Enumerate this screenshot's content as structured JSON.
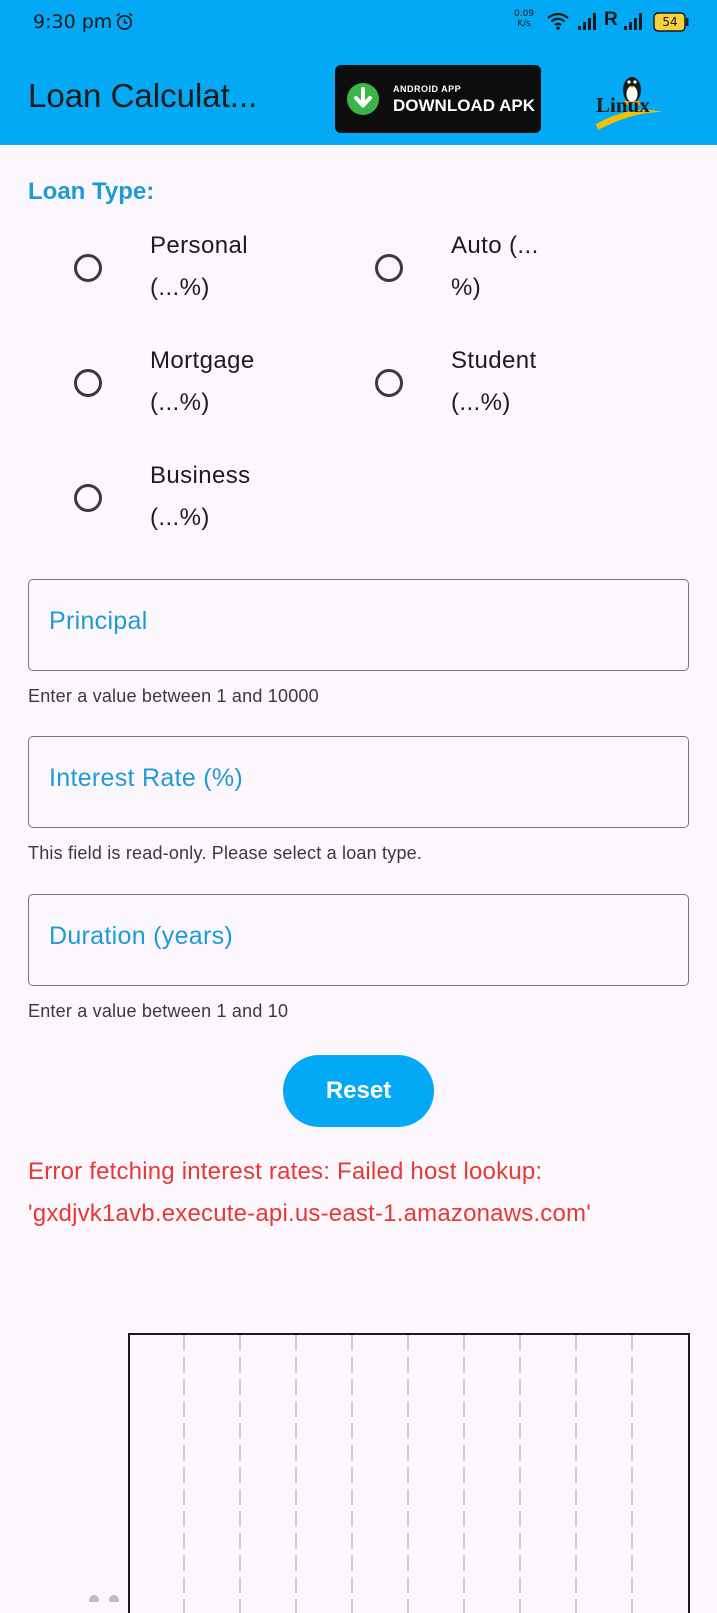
{
  "status_bar": {
    "time": "9:30 pm",
    "net_speed_value": "0.09",
    "net_speed_unit": "K/s",
    "roaming": "R",
    "battery": "54",
    "icons": [
      "alarm-icon",
      "wifi-icon",
      "signal-icon",
      "signal-icon",
      "battery-icon"
    ]
  },
  "app_bar": {
    "title": "Loan Calculat...",
    "apk_badge": {
      "small_text": "ANDROID APP",
      "big_text": "DOWNLOAD APK",
      "icon": "download-icon"
    },
    "logo_text": "Linux"
  },
  "loan_type": {
    "label": "Loan Type:",
    "options": [
      {
        "line1": "Personal",
        "line2": "(...%)"
      },
      {
        "line1": "Auto (...",
        "line2": "%)"
      },
      {
        "line1": "Mortgage",
        "line2": "(...%)"
      },
      {
        "line1": "Student",
        "line2": "(...%)"
      },
      {
        "line1": "Business",
        "line2": "(...%)"
      }
    ],
    "selected": null
  },
  "fields": {
    "principal": {
      "label": "Principal",
      "helper": "Enter a value between 1 and 10000"
    },
    "interest_rate": {
      "label": "Interest Rate (%)",
      "helper": "This field is read-only. Please select a loan type."
    },
    "duration": {
      "label": "Duration (years)",
      "helper": "Enter a value between 1 and 10"
    }
  },
  "reset_button": {
    "label": "Reset"
  },
  "error": {
    "line1": "Error fetching interest rates: Failed host lookup:",
    "line2": "'gxdjvk1avb.execute-api.us-east-1.amazonaws.com'"
  },
  "colors": {
    "accent": "#03a9f4",
    "label_blue": "#1e9ad6",
    "error": "#e53935",
    "background": "#fcf7fc"
  }
}
